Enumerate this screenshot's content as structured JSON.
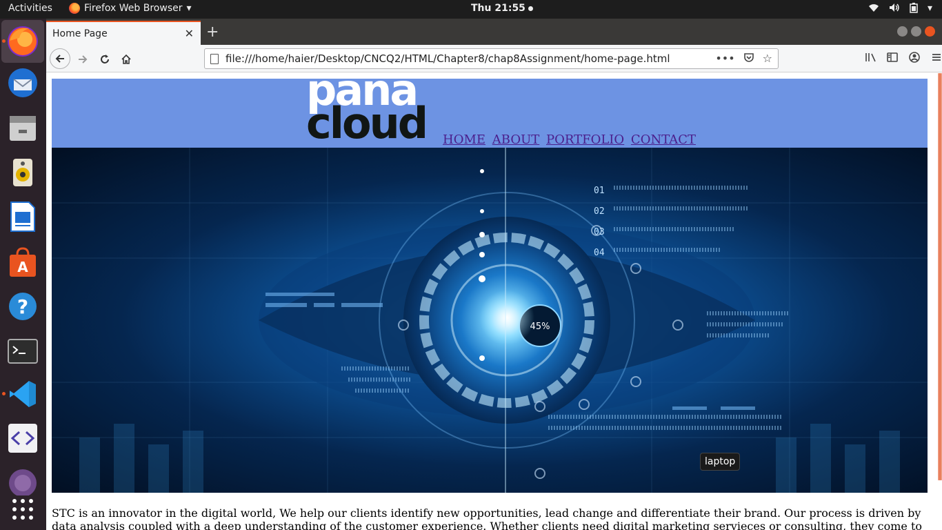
{
  "system": {
    "activities": "Activities",
    "app_name": "Firefox Web Browser",
    "clock": "Thu 21:55"
  },
  "browser": {
    "tab_title": "Home Page",
    "url": "file:///home/haier/Desktop/CNCQ2/HTML/Chapter8/chap8Assignment/home-page.html"
  },
  "site": {
    "logo_top": "pana",
    "logo_bottom": "cloud",
    "nav": [
      "HOME",
      "ABOUT",
      "PORTFOLIO",
      "CONTACT"
    ],
    "hero_tooltip": "laptop",
    "hero_rows": [
      "01",
      "02",
      "03",
      "04"
    ],
    "hero_percent": "45%",
    "intro_text": "STC is an innovator in the digital world, We help our clients identify new opportunities, lead change and differentiate their brand. Our process is driven by data analysis coupled with a deep understanding of the customer experience. Whether clients need digital marketing servieces or consulting, they come to"
  },
  "colors": {
    "header_bg": "#6d93e3",
    "nav_link": "#4b1f8c",
    "accent": "#e95420"
  }
}
